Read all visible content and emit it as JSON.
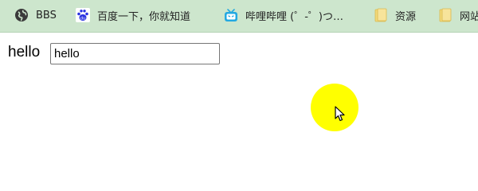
{
  "bookmarks": [
    {
      "label": "BBS",
      "icon": "globe-icon"
    },
    {
      "label": "百度一下，你就知道",
      "icon": "baidu-paw-icon"
    },
    {
      "label": "哔哩哔哩 (゜-゜)つ…",
      "icon": "bilibili-tv-icon"
    },
    {
      "label": "资源",
      "icon": "folder-icon"
    },
    {
      "label": "网站",
      "icon": "folder-icon"
    }
  ],
  "page": {
    "label": "hello",
    "input_value": "hello"
  },
  "colors": {
    "bookmarks_bar_bg": "#cde6cd",
    "circle": "#ffff00",
    "bilibili_blue": "#23a9e1",
    "baidu_blue": "#2932e1",
    "folder_yellow": "#f3d97a"
  }
}
